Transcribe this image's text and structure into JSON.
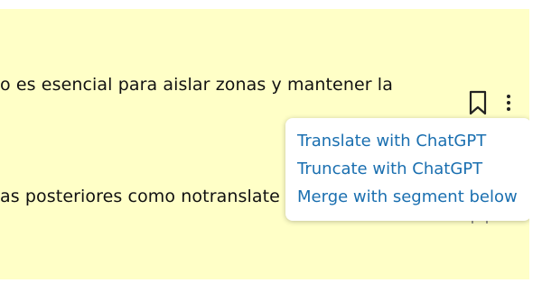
{
  "segments": [
    {
      "text": "o es esencial para aislar zonas y mantener la"
    },
    {
      "text": "as posteriores como notranslate"
    }
  ],
  "actions": {
    "bookmark_icon": "bookmark-icon",
    "more_icon": "kebab-menu-icon"
  },
  "menu": {
    "items": [
      {
        "label": "Translate with ChatGPT"
      },
      {
        "label": "Truncate with ChatGPT"
      },
      {
        "label": "Merge with segment below"
      }
    ]
  },
  "colors": {
    "panel_background": "#ffffc7",
    "menu_link": "#1a6fb0",
    "text": "#111111"
  }
}
